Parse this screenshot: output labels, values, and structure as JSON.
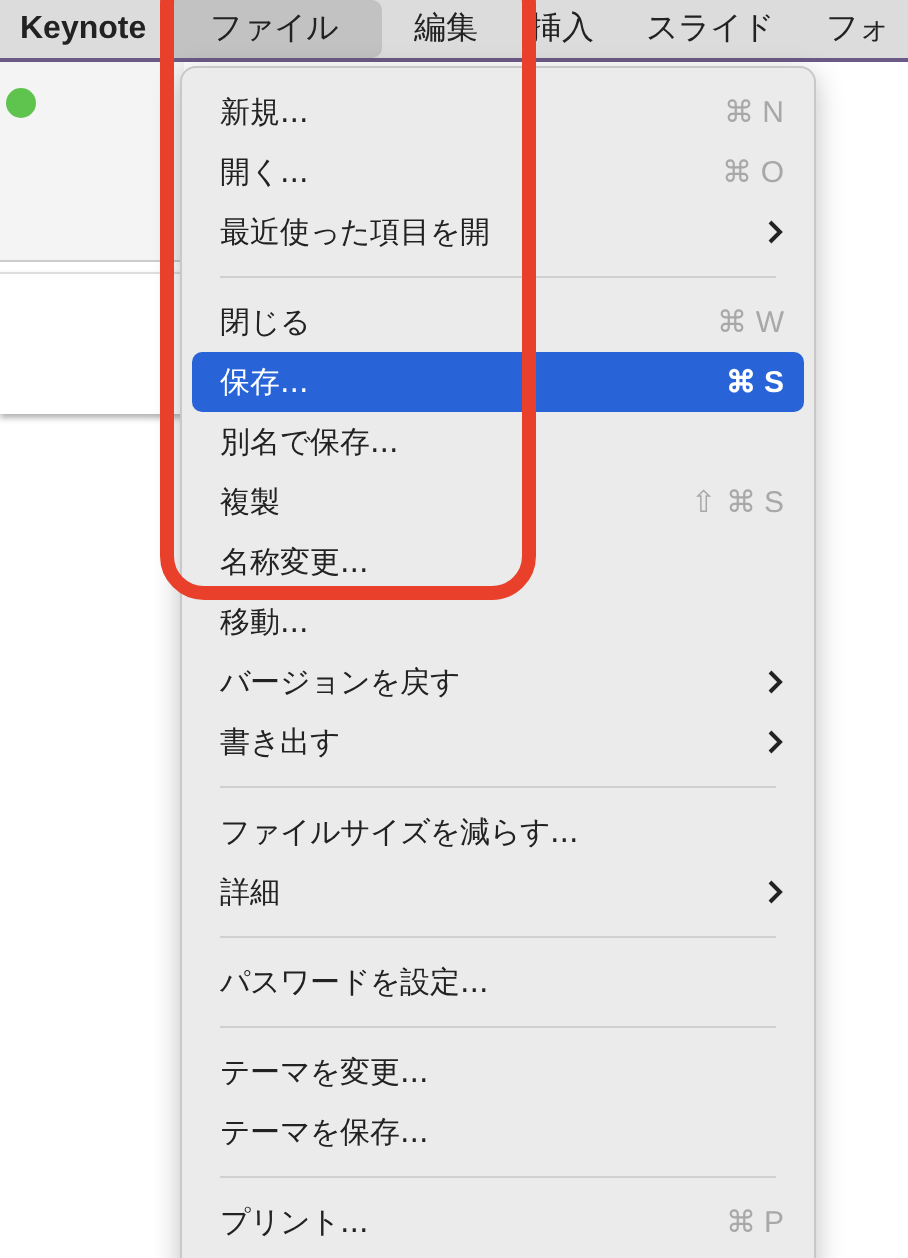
{
  "menu_bar": {
    "items": [
      {
        "label": "Keynote",
        "kind": "app",
        "selected": false
      },
      {
        "label": "ファイル",
        "kind": "menu",
        "selected": true
      },
      {
        "label": "編集",
        "kind": "menu",
        "selected": false
      },
      {
        "label": "挿入",
        "kind": "menu",
        "selected": false
      },
      {
        "label": "スライド",
        "kind": "menu",
        "selected": false
      },
      {
        "label": "フォ",
        "kind": "menu",
        "selected": false
      }
    ]
  },
  "file_menu": {
    "items": [
      {
        "kind": "item",
        "label": "新規...",
        "shortcut": "⌘ N",
        "submenu": false,
        "selected": false
      },
      {
        "kind": "item",
        "label": "開く...",
        "shortcut": "⌘ O",
        "submenu": false,
        "selected": false
      },
      {
        "kind": "item",
        "label": "最近使った項目を開",
        "submenu": true,
        "selected": false
      },
      {
        "kind": "separator"
      },
      {
        "kind": "item",
        "label": "閉じる",
        "shortcut": "⌘ W",
        "submenu": false,
        "selected": false
      },
      {
        "kind": "item",
        "label": "保存...",
        "shortcut": "⌘ S",
        "submenu": false,
        "selected": true
      },
      {
        "kind": "item",
        "label": "別名で保存...",
        "submenu": false,
        "selected": false
      },
      {
        "kind": "item",
        "label": "複製",
        "shortcut": "⇧ ⌘ S",
        "submenu": false,
        "selected": false
      },
      {
        "kind": "item",
        "label": "名称変更...",
        "submenu": false,
        "selected": false
      },
      {
        "kind": "item",
        "label": "移動...",
        "submenu": false,
        "selected": false
      },
      {
        "kind": "item",
        "label": "バージョンを戻す",
        "submenu": true,
        "selected": false
      },
      {
        "kind": "item",
        "label": "書き出す",
        "submenu": true,
        "selected": false
      },
      {
        "kind": "separator"
      },
      {
        "kind": "item",
        "label": "ファイルサイズを減らす...",
        "submenu": false,
        "selected": false
      },
      {
        "kind": "item",
        "label": "詳細",
        "submenu": true,
        "selected": false
      },
      {
        "kind": "separator"
      },
      {
        "kind": "item",
        "label": "パスワードを設定...",
        "submenu": false,
        "selected": false
      },
      {
        "kind": "separator"
      },
      {
        "kind": "item",
        "label": "テーマを変更...",
        "submenu": false,
        "selected": false
      },
      {
        "kind": "item",
        "label": "テーマを保存...",
        "submenu": false,
        "selected": false
      },
      {
        "kind": "separator"
      },
      {
        "kind": "item",
        "label": "プリント...",
        "shortcut": "⌘ P",
        "submenu": false,
        "selected": false
      }
    ]
  }
}
